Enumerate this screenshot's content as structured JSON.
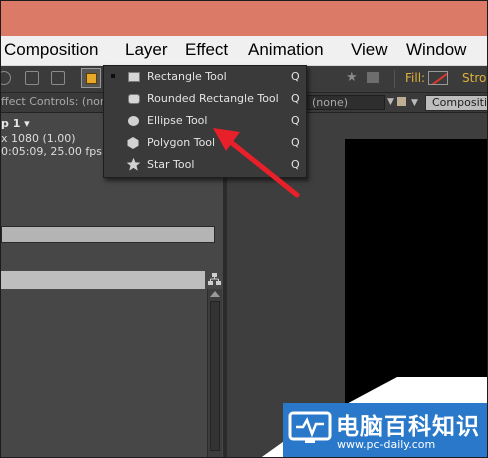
{
  "menubar": {
    "items": [
      "Composition",
      "Layer",
      "Effect",
      "Animation",
      "View",
      "Window"
    ]
  },
  "toolbar": {
    "fill_label": "Fill:",
    "stroke_label": "Strok",
    "active_tool_icon": "rectangle-tool-icon",
    "accent_color": "#e9a829",
    "fill_swatch": "none (red slash)"
  },
  "panels": {
    "effect_controls_label": "ffect Controls: (nor",
    "viewer_dropdown": "(none)",
    "composition_tab": "Compositi",
    "project_name": "p 1 ▾",
    "project_resolution": "x 1080 (1.00)",
    "project_duration": "0:05:09, 25.00 fps"
  },
  "shape_menu": {
    "items": [
      {
        "label": "Rectangle Tool",
        "shortcut": "Q",
        "icon": "rectangle-icon",
        "selected": true
      },
      {
        "label": "Rounded Rectangle Tool",
        "shortcut": "Q",
        "icon": "rounded-rectangle-icon",
        "selected": false
      },
      {
        "label": "Ellipse Tool",
        "shortcut": "Q",
        "icon": "ellipse-icon",
        "selected": false
      },
      {
        "label": "Polygon Tool",
        "shortcut": "Q",
        "icon": "polygon-icon",
        "selected": false
      },
      {
        "label": "Star Tool",
        "shortcut": "Q",
        "icon": "star-icon",
        "selected": false
      }
    ]
  },
  "annotation": {
    "arrow_color": "#e8202a",
    "points_to": "Ellipse Tool"
  },
  "watermark": {
    "title": "电脑百科知识",
    "url": "www.pc-daily.com",
    "color": "#2a78c9"
  }
}
